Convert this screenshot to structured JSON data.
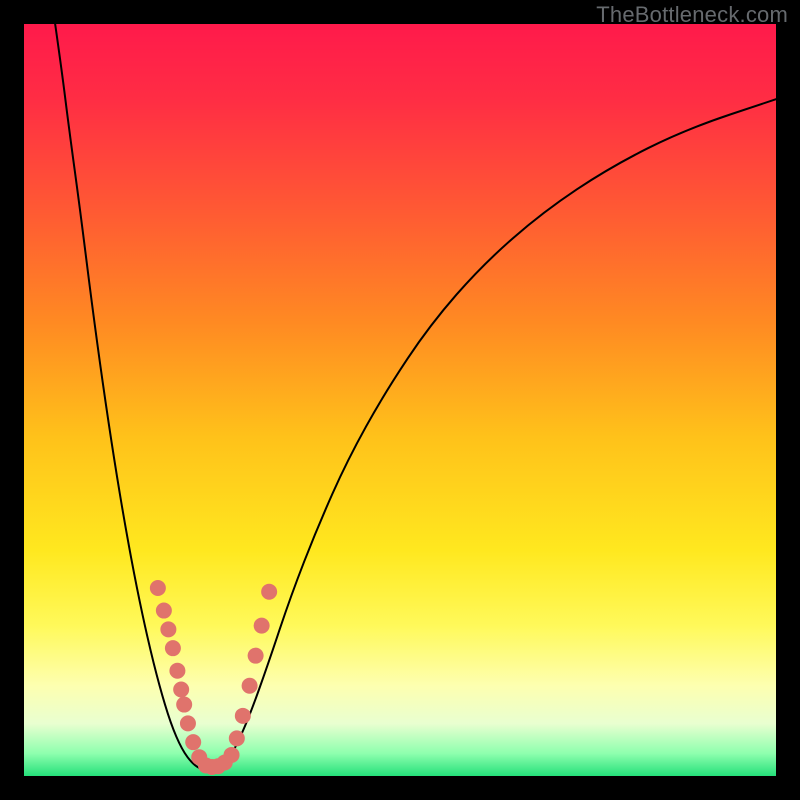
{
  "watermark": "TheBottleneck.com",
  "chart_data": {
    "type": "line",
    "title": "",
    "xlabel": "",
    "ylabel": "",
    "xlim": [
      0,
      100
    ],
    "ylim": [
      0,
      100
    ],
    "background_gradient": {
      "stops": [
        {
          "offset": 0.0,
          "color": "#ff1a4b"
        },
        {
          "offset": 0.1,
          "color": "#ff2d44"
        },
        {
          "offset": 0.25,
          "color": "#ff5a33"
        },
        {
          "offset": 0.4,
          "color": "#ff8b22"
        },
        {
          "offset": 0.55,
          "color": "#ffc21a"
        },
        {
          "offset": 0.7,
          "color": "#ffe81f"
        },
        {
          "offset": 0.8,
          "color": "#fff95a"
        },
        {
          "offset": 0.88,
          "color": "#fdffb0"
        },
        {
          "offset": 0.93,
          "color": "#e9ffd0"
        },
        {
          "offset": 0.97,
          "color": "#8effae"
        },
        {
          "offset": 1.0,
          "color": "#25e07a"
        }
      ]
    },
    "series": [
      {
        "name": "left-curve",
        "stroke": "#000000",
        "stroke_width": 2,
        "points": [
          {
            "x": 4.0,
            "y": 101.0
          },
          {
            "x": 5.0,
            "y": 94.0
          },
          {
            "x": 6.0,
            "y": 86.0
          },
          {
            "x": 7.5,
            "y": 75.0
          },
          {
            "x": 9.0,
            "y": 63.0
          },
          {
            "x": 10.5,
            "y": 52.0
          },
          {
            "x": 12.0,
            "y": 42.0
          },
          {
            "x": 13.5,
            "y": 33.0
          },
          {
            "x": 15.0,
            "y": 25.0
          },
          {
            "x": 16.5,
            "y": 18.0
          },
          {
            "x": 18.0,
            "y": 12.0
          },
          {
            "x": 19.5,
            "y": 7.0
          },
          {
            "x": 21.0,
            "y": 3.5
          },
          {
            "x": 22.5,
            "y": 1.5
          },
          {
            "x": 24.0,
            "y": 0.7
          },
          {
            "x": 25.0,
            "y": 0.4
          }
        ]
      },
      {
        "name": "right-curve",
        "stroke": "#000000",
        "stroke_width": 2,
        "points": [
          {
            "x": 25.0,
            "y": 0.4
          },
          {
            "x": 26.5,
            "y": 1.2
          },
          {
            "x": 28.0,
            "y": 3.5
          },
          {
            "x": 30.0,
            "y": 8.0
          },
          {
            "x": 32.5,
            "y": 15.0
          },
          {
            "x": 35.5,
            "y": 24.0
          },
          {
            "x": 39.0,
            "y": 33.0
          },
          {
            "x": 43.0,
            "y": 42.0
          },
          {
            "x": 48.0,
            "y": 51.0
          },
          {
            "x": 54.0,
            "y": 60.0
          },
          {
            "x": 61.0,
            "y": 68.0
          },
          {
            "x": 69.0,
            "y": 75.0
          },
          {
            "x": 78.0,
            "y": 81.0
          },
          {
            "x": 88.0,
            "y": 86.0
          },
          {
            "x": 100.0,
            "y": 90.0
          }
        ]
      }
    ],
    "markers": {
      "fill": "#e0736c",
      "radius_px": 8,
      "points": [
        {
          "x": 17.8,
          "y": 25.0
        },
        {
          "x": 18.6,
          "y": 22.0
        },
        {
          "x": 19.2,
          "y": 19.5
        },
        {
          "x": 19.8,
          "y": 17.0
        },
        {
          "x": 20.4,
          "y": 14.0
        },
        {
          "x": 20.9,
          "y": 11.5
        },
        {
          "x": 21.3,
          "y": 9.5
        },
        {
          "x": 21.8,
          "y": 7.0
        },
        {
          "x": 22.5,
          "y": 4.5
        },
        {
          "x": 23.3,
          "y": 2.5
        },
        {
          "x": 24.2,
          "y": 1.4
        },
        {
          "x": 25.0,
          "y": 1.2
        },
        {
          "x": 25.8,
          "y": 1.3
        },
        {
          "x": 26.7,
          "y": 1.8
        },
        {
          "x": 27.6,
          "y": 2.8
        },
        {
          "x": 28.3,
          "y": 5.0
        },
        {
          "x": 29.1,
          "y": 8.0
        },
        {
          "x": 30.0,
          "y": 12.0
        },
        {
          "x": 30.8,
          "y": 16.0
        },
        {
          "x": 31.6,
          "y": 20.0
        },
        {
          "x": 32.6,
          "y": 24.5
        }
      ]
    }
  }
}
